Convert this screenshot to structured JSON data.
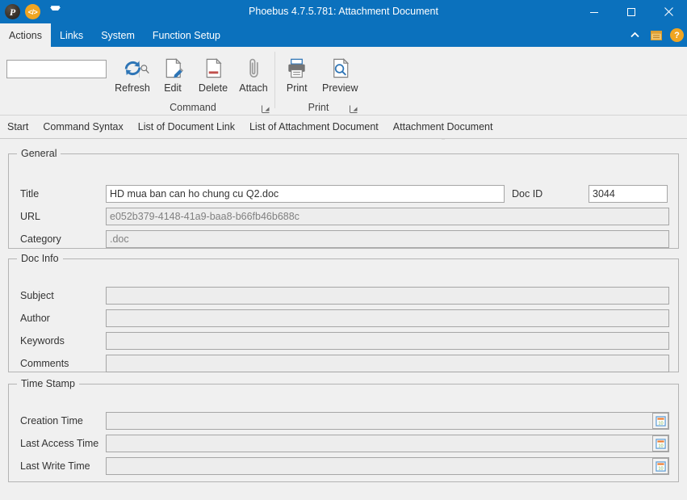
{
  "window": {
    "title": "Phoebus 4.7.5.781: Attachment Document",
    "app_logo_glyph": "P",
    "qat_code_glyph": "</>",
    "minimize_label": "Minimize",
    "maximize_label": "Maximize",
    "close_label": "Close"
  },
  "ribbon_tabs": [
    {
      "label": "Actions",
      "active": true
    },
    {
      "label": "Links",
      "active": false
    },
    {
      "label": "System",
      "active": false
    },
    {
      "label": "Function Setup",
      "active": false
    }
  ],
  "ribbon_right": {
    "collapse_label": "^",
    "window_list_label": "Window List",
    "help_label": "?"
  },
  "search": {
    "value": "",
    "placeholder": "",
    "icon": "search-icon"
  },
  "ribbon_groups": [
    {
      "title": "Command",
      "buttons": [
        {
          "label": "Refresh",
          "icon": "refresh-icon"
        },
        {
          "label": "Edit",
          "icon": "edit-document-icon"
        },
        {
          "label": "Delete",
          "icon": "delete-document-icon"
        },
        {
          "label": "Attach",
          "icon": "paperclip-icon"
        }
      ]
    },
    {
      "title": "Print",
      "buttons": [
        {
          "label": "Print",
          "icon": "printer-icon"
        },
        {
          "label": "Preview",
          "icon": "print-preview-icon"
        }
      ]
    }
  ],
  "document_tabs": [
    {
      "label": "Start",
      "active": false
    },
    {
      "label": "Command Syntax",
      "active": false
    },
    {
      "label": "List of Document Link",
      "active": false
    },
    {
      "label": "List of Attachment Document",
      "active": false
    },
    {
      "label": "Attachment Document",
      "active": true
    }
  ],
  "sections": {
    "general": {
      "legend": "General",
      "title": {
        "label": "Title",
        "value": "HD mua ban can ho chung cu Q2.doc",
        "editable": true
      },
      "doc_id": {
        "label": "Doc ID",
        "value": "3044",
        "editable": true
      },
      "url": {
        "label": "URL",
        "value": "e052b379-4148-41a9-baa8-b66fb46b688c",
        "editable": false
      },
      "category": {
        "label": "Category",
        "value": ".doc",
        "editable": false
      }
    },
    "doc_info": {
      "legend": "Doc Info",
      "fields": [
        {
          "label": "Subject",
          "value": ""
        },
        {
          "label": "Author",
          "value": ""
        },
        {
          "label": "Keywords",
          "value": ""
        },
        {
          "label": "Comments",
          "value": ""
        }
      ]
    },
    "time_stamp": {
      "legend": "Time Stamp",
      "fields": [
        {
          "label": "Creation Time",
          "value": "",
          "icon": "calendar-icon"
        },
        {
          "label": "Last Access Time",
          "value": "",
          "icon": "calendar-icon"
        },
        {
          "label": "Last Write Time",
          "value": "",
          "icon": "calendar-icon"
        }
      ]
    }
  },
  "colors": {
    "titlebar": "#0b71bd",
    "surface": "#f0f0f0",
    "field_readonly": "#ededed",
    "field_editable": "#ffffff",
    "accent_orange": "#f0a522",
    "icon_blue": "#2e75b6"
  }
}
